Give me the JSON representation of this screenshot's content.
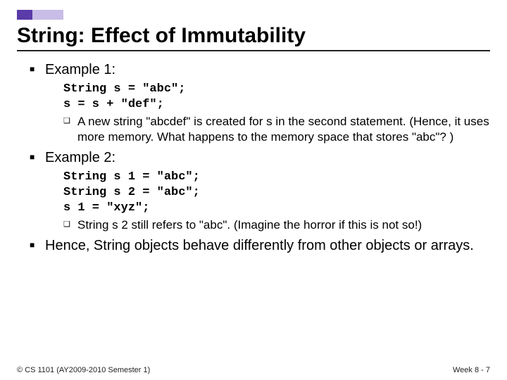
{
  "title": "String: Effect of Immutability",
  "items": [
    {
      "label": "Example 1:",
      "code": "String s = \"abc\";\ns = s + \"def\";",
      "sub": "A new string \"abcdef\" is created for s in the second statement. (Hence, it uses more memory. What happens to the memory space that stores \"abc\"? )"
    },
    {
      "label": "Example 2:",
      "code": "String s 1 = \"abc\";\nString s 2 = \"abc\";\ns 1 = \"xyz\";",
      "sub": "String s 2 still refers to \"abc\". (Imagine the horror if this is not so!)"
    },
    {
      "label": "Hence, String objects behave differently from other objects or arrays."
    }
  ],
  "footer": {
    "left": "© CS 1101 (AY2009-2010 Semester 1)",
    "right": "Week 8 - 7"
  }
}
